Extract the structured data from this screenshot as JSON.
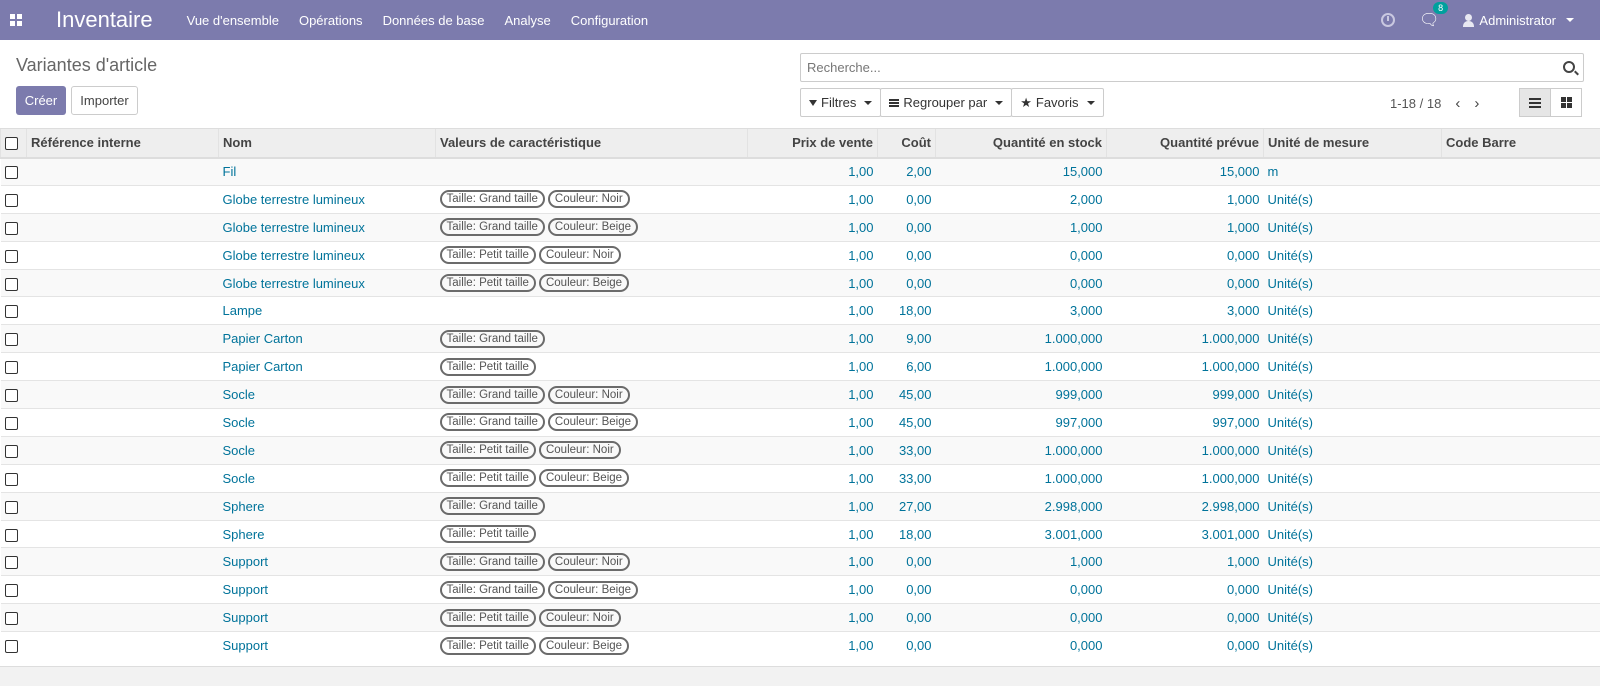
{
  "topbar": {
    "app_name": "Inventaire",
    "menu": [
      "Vue d'ensemble",
      "Opérations",
      "Données de base",
      "Analyse",
      "Configuration"
    ],
    "messages_count": "8",
    "user": "Administrator"
  },
  "page": {
    "title": "Variantes d'article",
    "create_label": "Créer",
    "import_label": "Importer"
  },
  "search": {
    "placeholder": "Recherche..."
  },
  "filters": {
    "filters_label": "Filtres",
    "group_label": "Regrouper par",
    "favorites_label": "Favoris"
  },
  "pager": {
    "range": "1-18 / 18"
  },
  "table": {
    "headers": [
      "Référence interne",
      "Nom",
      "Valeurs de caractéristique",
      "Prix de vente",
      "Coût",
      "Quantité en stock",
      "Quantité prévue",
      "Unité de mesure",
      "Code Barre"
    ],
    "rows": [
      {
        "ref": "",
        "name": "Fil",
        "tags": [],
        "price": "1,00",
        "cost": "2,00",
        "stock": "15,000",
        "forecast": "15,000",
        "uom": "m",
        "barcode": ""
      },
      {
        "ref": "",
        "name": "Globe terrestre lumineux",
        "tags": [
          "Taille: Grand taille",
          "Couleur: Noir"
        ],
        "price": "1,00",
        "cost": "0,00",
        "stock": "2,000",
        "forecast": "1,000",
        "uom": "Unité(s)",
        "barcode": ""
      },
      {
        "ref": "",
        "name": "Globe terrestre lumineux",
        "tags": [
          "Taille: Grand taille",
          "Couleur: Beige"
        ],
        "price": "1,00",
        "cost": "0,00",
        "stock": "1,000",
        "forecast": "1,000",
        "uom": "Unité(s)",
        "barcode": ""
      },
      {
        "ref": "",
        "name": "Globe terrestre lumineux",
        "tags": [
          "Taille: Petit taille",
          "Couleur: Noir"
        ],
        "price": "1,00",
        "cost": "0,00",
        "stock": "0,000",
        "forecast": "0,000",
        "uom": "Unité(s)",
        "barcode": ""
      },
      {
        "ref": "",
        "name": "Globe terrestre lumineux",
        "tags": [
          "Taille: Petit taille",
          "Couleur: Beige"
        ],
        "price": "1,00",
        "cost": "0,00",
        "stock": "0,000",
        "forecast": "0,000",
        "uom": "Unité(s)",
        "barcode": ""
      },
      {
        "ref": "",
        "name": "Lampe",
        "tags": [],
        "price": "1,00",
        "cost": "18,00",
        "stock": "3,000",
        "forecast": "3,000",
        "uom": "Unité(s)",
        "barcode": ""
      },
      {
        "ref": "",
        "name": "Papier Carton",
        "tags": [
          "Taille: Grand taille"
        ],
        "price": "1,00",
        "cost": "9,00",
        "stock": "1.000,000",
        "forecast": "1.000,000",
        "uom": "Unité(s)",
        "barcode": ""
      },
      {
        "ref": "",
        "name": "Papier Carton",
        "tags": [
          "Taille: Petit taille"
        ],
        "price": "1,00",
        "cost": "6,00",
        "stock": "1.000,000",
        "forecast": "1.000,000",
        "uom": "Unité(s)",
        "barcode": ""
      },
      {
        "ref": "",
        "name": "Socle",
        "tags": [
          "Taille: Grand taille",
          "Couleur: Noir"
        ],
        "price": "1,00",
        "cost": "45,00",
        "stock": "999,000",
        "forecast": "999,000",
        "uom": "Unité(s)",
        "barcode": ""
      },
      {
        "ref": "",
        "name": "Socle",
        "tags": [
          "Taille: Grand taille",
          "Couleur: Beige"
        ],
        "price": "1,00",
        "cost": "45,00",
        "stock": "997,000",
        "forecast": "997,000",
        "uom": "Unité(s)",
        "barcode": ""
      },
      {
        "ref": "",
        "name": "Socle",
        "tags": [
          "Taille: Petit taille",
          "Couleur: Noir"
        ],
        "price": "1,00",
        "cost": "33,00",
        "stock": "1.000,000",
        "forecast": "1.000,000",
        "uom": "Unité(s)",
        "barcode": ""
      },
      {
        "ref": "",
        "name": "Socle",
        "tags": [
          "Taille: Petit taille",
          "Couleur: Beige"
        ],
        "price": "1,00",
        "cost": "33,00",
        "stock": "1.000,000",
        "forecast": "1.000,000",
        "uom": "Unité(s)",
        "barcode": ""
      },
      {
        "ref": "",
        "name": "Sphere",
        "tags": [
          "Taille: Grand taille"
        ],
        "price": "1,00",
        "cost": "27,00",
        "stock": "2.998,000",
        "forecast": "2.998,000",
        "uom": "Unité(s)",
        "barcode": ""
      },
      {
        "ref": "",
        "name": "Sphere",
        "tags": [
          "Taille: Petit taille"
        ],
        "price": "1,00",
        "cost": "18,00",
        "stock": "3.001,000",
        "forecast": "3.001,000",
        "uom": "Unité(s)",
        "barcode": ""
      },
      {
        "ref": "",
        "name": "Support",
        "tags": [
          "Taille: Grand taille",
          "Couleur: Noir"
        ],
        "price": "1,00",
        "cost": "0,00",
        "stock": "1,000",
        "forecast": "1,000",
        "uom": "Unité(s)",
        "barcode": ""
      },
      {
        "ref": "",
        "name": "Support",
        "tags": [
          "Taille: Grand taille",
          "Couleur: Beige"
        ],
        "price": "1,00",
        "cost": "0,00",
        "stock": "0,000",
        "forecast": "0,000",
        "uom": "Unité(s)",
        "barcode": ""
      },
      {
        "ref": "",
        "name": "Support",
        "tags": [
          "Taille: Petit taille",
          "Couleur: Noir"
        ],
        "price": "1,00",
        "cost": "0,00",
        "stock": "0,000",
        "forecast": "0,000",
        "uom": "Unité(s)",
        "barcode": ""
      },
      {
        "ref": "",
        "name": "Support",
        "tags": [
          "Taille: Petit taille",
          "Couleur: Beige"
        ],
        "price": "1,00",
        "cost": "0,00",
        "stock": "0,000",
        "forecast": "0,000",
        "uom": "Unité(s)",
        "barcode": ""
      }
    ]
  }
}
